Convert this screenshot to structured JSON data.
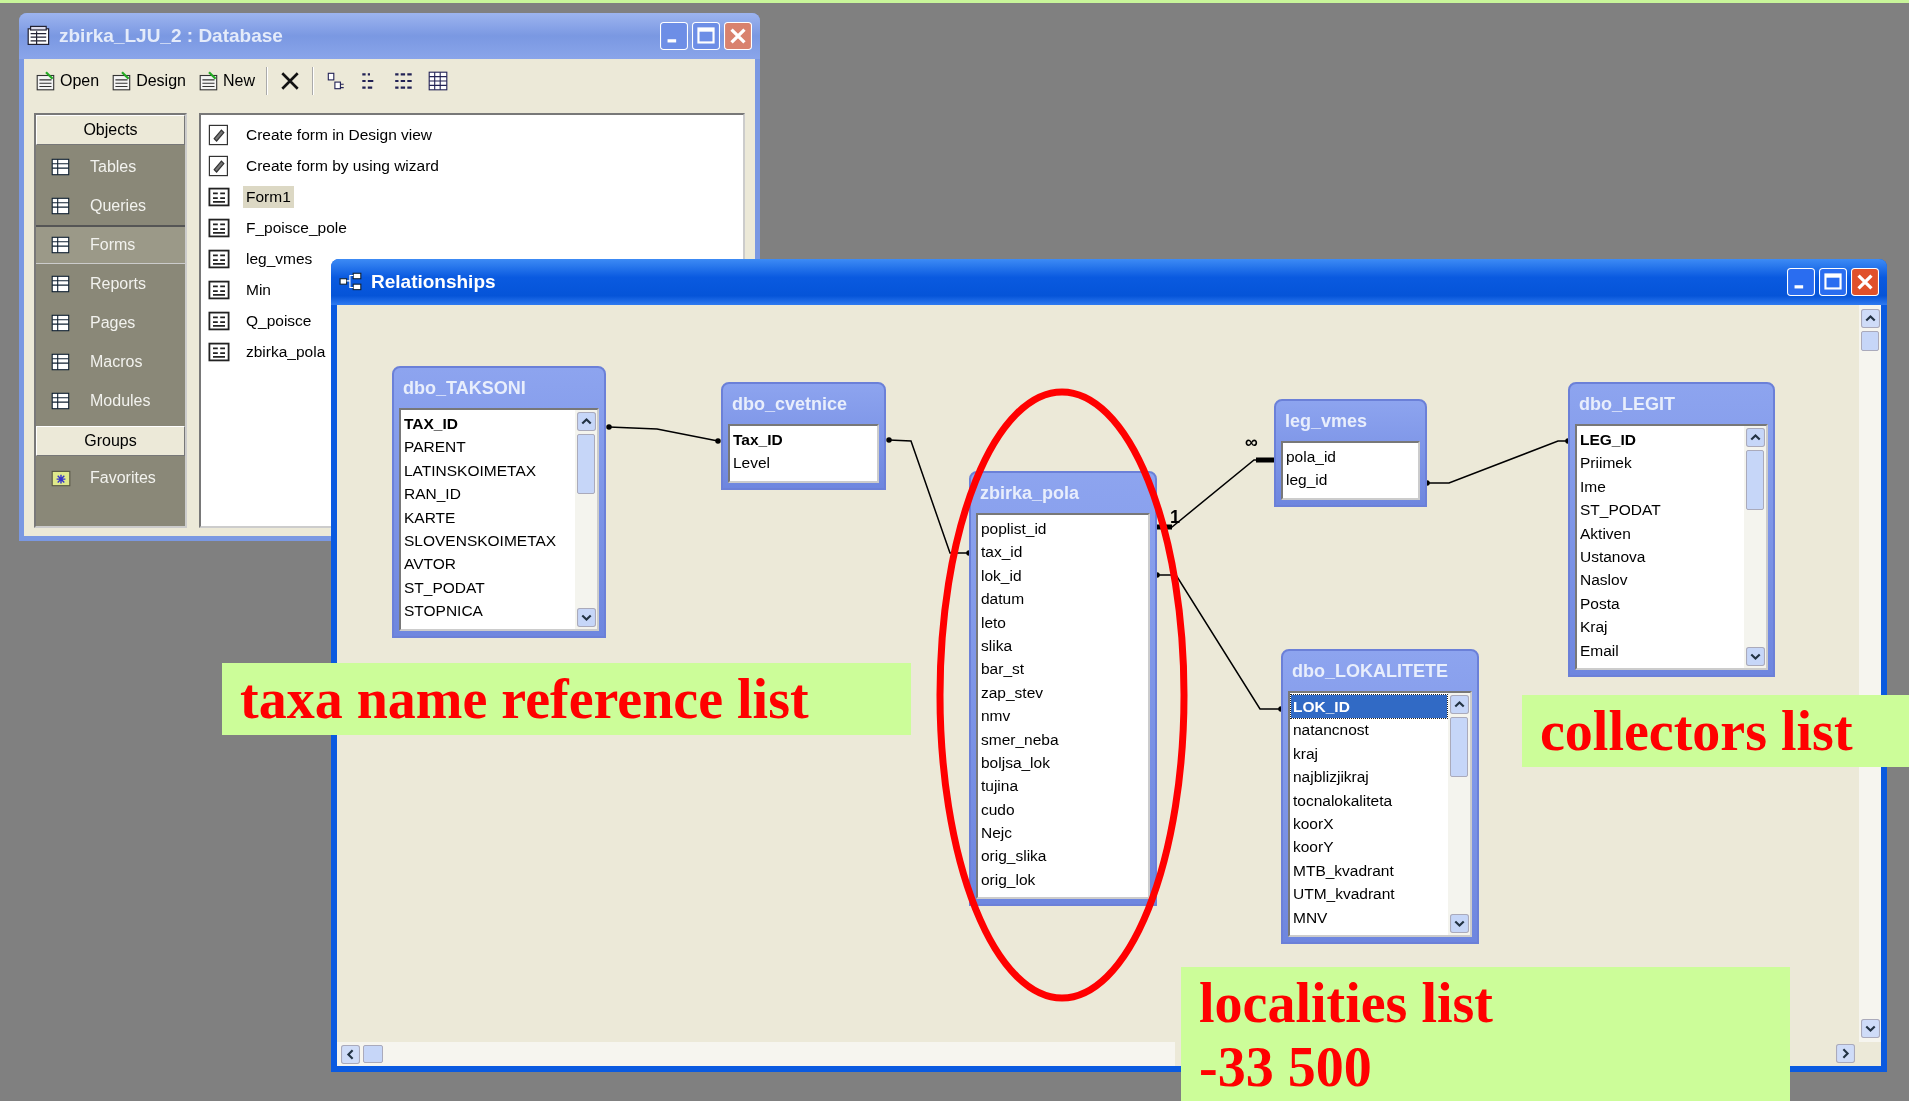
{
  "database_window": {
    "title": "zbirka_LJU_2 : Database",
    "toolbar": [
      {
        "label": "Open"
      },
      {
        "label": "Design"
      },
      {
        "label": "New"
      }
    ],
    "sidebar": {
      "objects_header": "Objects",
      "objects": [
        {
          "label": "Tables",
          "selected": false
        },
        {
          "label": "Queries",
          "selected": false
        },
        {
          "label": "Forms",
          "selected": true
        },
        {
          "label": "Reports",
          "selected": false
        },
        {
          "label": "Pages",
          "selected": false
        },
        {
          "label": "Macros",
          "selected": false
        },
        {
          "label": "Modules",
          "selected": false
        }
      ],
      "groups_header": "Groups",
      "groups": [
        {
          "label": "Favorites"
        }
      ]
    },
    "items": [
      {
        "label": "Create form in Design view",
        "kind": "shortcut",
        "selected": false
      },
      {
        "label": "Create form by using wizard",
        "kind": "shortcut",
        "selected": false
      },
      {
        "label": "Form1",
        "kind": "form",
        "selected": true
      },
      {
        "label": "F_poisce_pole",
        "kind": "form",
        "selected": false
      },
      {
        "label": "leg_vmes",
        "kind": "form",
        "selected": false
      },
      {
        "label": "Min",
        "kind": "form",
        "selected": false
      },
      {
        "label": "Q_poisce",
        "kind": "form",
        "selected": false
      },
      {
        "label": "zbirka_pola",
        "kind": "form",
        "selected": false
      }
    ]
  },
  "relationships_window": {
    "title": "Relationships",
    "tables": [
      {
        "name": "dbo_TAKSONI",
        "scrollbar": true,
        "fields": [
          {
            "name": "TAX_ID",
            "primary_key": true,
            "selected": false
          },
          {
            "name": "PARENT",
            "primary_key": false,
            "selected": false
          },
          {
            "name": "LATINSKOIMETAX",
            "primary_key": false,
            "selected": false
          },
          {
            "name": "RAN_ID",
            "primary_key": false,
            "selected": false
          },
          {
            "name": "KARTE",
            "primary_key": false,
            "selected": false
          },
          {
            "name": "SLOVENSKOIMETAX",
            "primary_key": false,
            "selected": false
          },
          {
            "name": "AVTOR",
            "primary_key": false,
            "selected": false
          },
          {
            "name": "ST_PODAT",
            "primary_key": false,
            "selected": false
          },
          {
            "name": "STOPNICA",
            "primary_key": false,
            "selected": false
          }
        ]
      },
      {
        "name": "dbo_cvetnice",
        "scrollbar": false,
        "fields": [
          {
            "name": "Tax_ID",
            "primary_key": true,
            "selected": false
          },
          {
            "name": "Level",
            "primary_key": false,
            "selected": false
          }
        ]
      },
      {
        "name": "zbirka_pola",
        "scrollbar": false,
        "fields": [
          {
            "name": "poplist_id",
            "primary_key": false,
            "selected": false
          },
          {
            "name": "tax_id",
            "primary_key": false,
            "selected": false
          },
          {
            "name": "lok_id",
            "primary_key": false,
            "selected": false
          },
          {
            "name": "datum",
            "primary_key": false,
            "selected": false
          },
          {
            "name": "leto",
            "primary_key": false,
            "selected": false
          },
          {
            "name": "slika",
            "primary_key": false,
            "selected": false
          },
          {
            "name": "bar_st",
            "primary_key": false,
            "selected": false
          },
          {
            "name": "zap_stev",
            "primary_key": false,
            "selected": false
          },
          {
            "name": "nmv",
            "primary_key": false,
            "selected": false
          },
          {
            "name": "smer_neba",
            "primary_key": false,
            "selected": false
          },
          {
            "name": "boljsa_lok",
            "primary_key": false,
            "selected": false
          },
          {
            "name": "tujina",
            "primary_key": false,
            "selected": false
          },
          {
            "name": "cudo",
            "primary_key": false,
            "selected": false
          },
          {
            "name": "Nejc",
            "primary_key": false,
            "selected": false
          },
          {
            "name": "orig_slika",
            "primary_key": false,
            "selected": false
          },
          {
            "name": "orig_lok",
            "primary_key": false,
            "selected": false
          }
        ]
      },
      {
        "name": "leg_vmes",
        "scrollbar": false,
        "fields": [
          {
            "name": "pola_id",
            "primary_key": false,
            "selected": false
          },
          {
            "name": "leg_id",
            "primary_key": false,
            "selected": false
          }
        ]
      },
      {
        "name": "dbo_LEGIT",
        "scrollbar": true,
        "fields": [
          {
            "name": "LEG_ID",
            "primary_key": true,
            "selected": false
          },
          {
            "name": "Priimek",
            "primary_key": false,
            "selected": false
          },
          {
            "name": "Ime",
            "primary_key": false,
            "selected": false
          },
          {
            "name": "ST_PODAT",
            "primary_key": false,
            "selected": false
          },
          {
            "name": "Aktiven",
            "primary_key": false,
            "selected": false
          },
          {
            "name": "Ustanova",
            "primary_key": false,
            "selected": false
          },
          {
            "name": "Naslov",
            "primary_key": false,
            "selected": false
          },
          {
            "name": "Posta",
            "primary_key": false,
            "selected": false
          },
          {
            "name": "Kraj",
            "primary_key": false,
            "selected": false
          },
          {
            "name": "Email",
            "primary_key": false,
            "selected": false
          }
        ]
      },
      {
        "name": "dbo_LOKALITETE",
        "scrollbar": true,
        "fields": [
          {
            "name": "LOK_ID",
            "primary_key": true,
            "selected": true
          },
          {
            "name": "natancnost",
            "primary_key": false,
            "selected": false
          },
          {
            "name": "kraj",
            "primary_key": false,
            "selected": false
          },
          {
            "name": "najblizjikraj",
            "primary_key": false,
            "selected": false
          },
          {
            "name": "tocnalokaliteta",
            "primary_key": false,
            "selected": false
          },
          {
            "name": "koorX",
            "primary_key": false,
            "selected": false
          },
          {
            "name": "koorY",
            "primary_key": false,
            "selected": false
          },
          {
            "name": "MTB_kvadrant",
            "primary_key": false,
            "selected": false
          },
          {
            "name": "UTM_kvadrant",
            "primary_key": false,
            "selected": false
          },
          {
            "name": "MNV",
            "primary_key": false,
            "selected": false
          }
        ]
      }
    ],
    "join_labels": [
      "1",
      "∞"
    ]
  },
  "annotations": [
    {
      "lines": [
        "taxa name reference list"
      ]
    },
    {
      "lines": [
        "collectors list"
      ]
    },
    {
      "lines": [
        "localities list",
        "-33 500"
      ]
    }
  ]
}
